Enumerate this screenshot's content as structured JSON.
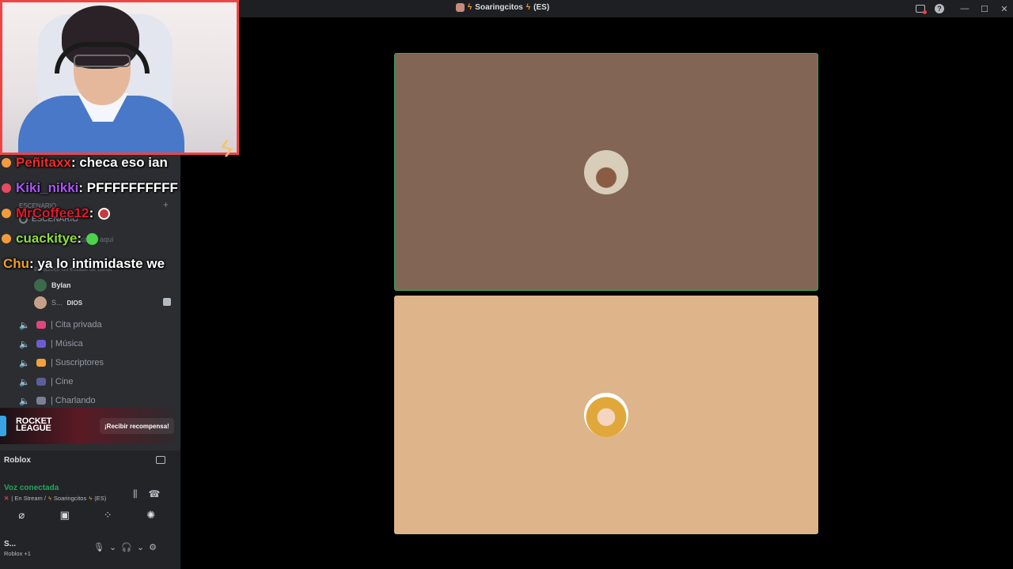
{
  "window": {
    "title": "Soaringcitos",
    "title_suffix": "(ES)",
    "bolt_glyph": "ϟ",
    "help_label": "?"
  },
  "sidebar": {
    "stage_header": "ESCENARIO",
    "stage_channel": "ESCENARIO",
    "ghost_invite": "Crea tu canal aquí",
    "ghost_status": "Establece un estado de canal",
    "members": [
      {
        "name": "ByIan"
      },
      {
        "name": "S...",
        "tag": "DIOS"
      }
    ],
    "channels": [
      {
        "label": "| Cita privada",
        "icon_color": "#e0467a"
      },
      {
        "label": "| Música",
        "icon_color": "#6b5fd0"
      },
      {
        "label": "| Suscriptores",
        "icon_color": "#f2a23c"
      },
      {
        "label": "| Cine",
        "icon_color": "#5a5f9a"
      },
      {
        "label": "| Charlando",
        "icon_color": "#7a8196"
      }
    ]
  },
  "chat_overlay": [
    {
      "user": "Peñitaxx",
      "user_color": "#ef2b2b",
      "message": ": checa eso ian",
      "badge": "#f39b3c"
    },
    {
      "user": "Kiki_nikki",
      "user_color": "#a855f7",
      "message": ": PFFFFFFFFFF",
      "badge": "#e84a5f"
    },
    {
      "user": "MrCoffee12",
      "user_color": "#e0182b",
      "message": ":",
      "badge": "#f39b3c",
      "emote": "#c73a3a"
    },
    {
      "user": "cuackitye",
      "user_color": "#8fdc3c",
      "message": ":",
      "badge": "#f39b3c",
      "emote": "#4cd24c"
    },
    {
      "user": "Chu",
      "user_color": "#f0a020",
      "message": ": ya lo intimidaste we",
      "badge": ""
    }
  ],
  "promo": {
    "game_logo": "ROCKET LEAGUE",
    "cta": "¡Recibir recompensa!"
  },
  "activity": {
    "name": "Roblox"
  },
  "voice": {
    "status": "Voz conectada",
    "channel_prefix": "| En Stream /",
    "server": "Soaringcitos",
    "suffix": "(ES)"
  },
  "user": {
    "name": "S...",
    "status": "Roblox +1"
  },
  "stage_tiles": [
    {
      "speaking": true
    },
    {
      "speaking": false
    }
  ]
}
